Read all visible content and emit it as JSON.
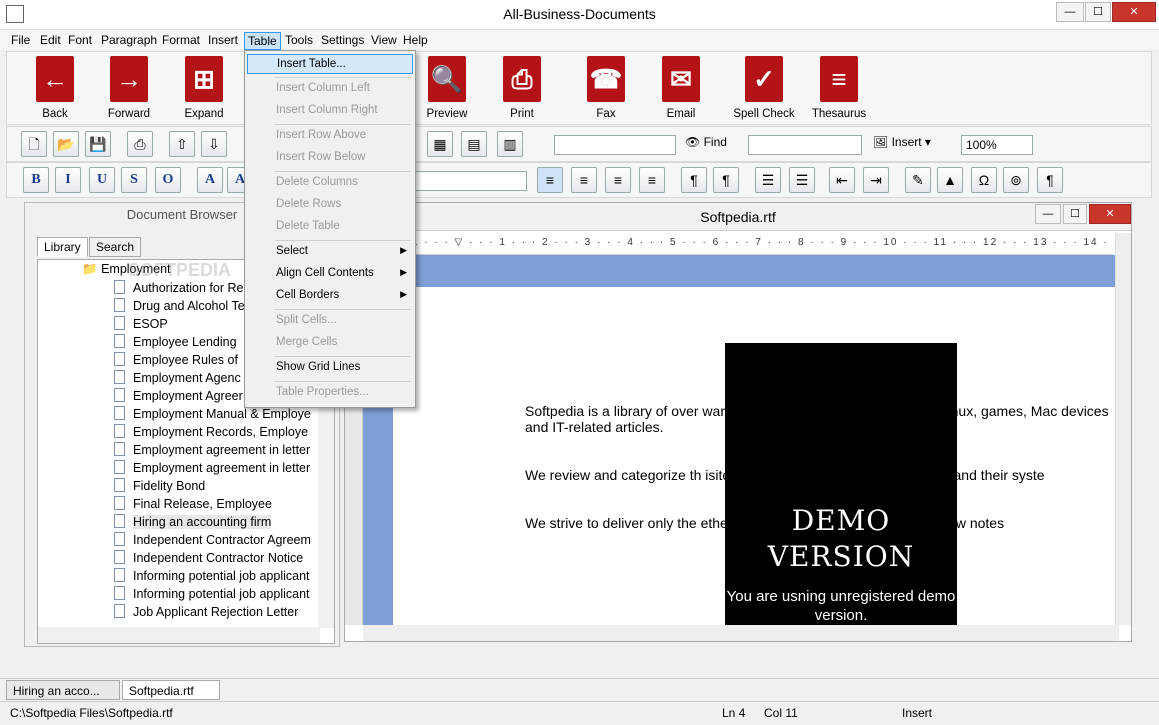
{
  "window": {
    "title": "All-Business-Documents",
    "minimize": "—",
    "maximize": "☐",
    "close": "✕"
  },
  "menubar": [
    "File",
    "Edit",
    "Font",
    "Paragraph",
    "Format",
    "Insert",
    "Table",
    "Tools",
    "Settings",
    "View",
    "Help"
  ],
  "big_toolbar": [
    {
      "label": "Back",
      "icon": "back-arrow-icon",
      "glyph": "←"
    },
    {
      "label": "Forward",
      "icon": "forward-arrow-icon",
      "glyph": "→"
    },
    {
      "label": "Expand",
      "icon": "expand-tree-icon",
      "glyph": "⊞"
    },
    {
      "label": "Preview",
      "icon": "preview-magnifier-icon",
      "glyph": "🔍"
    },
    {
      "label": "Print",
      "icon": "printer-icon",
      "glyph": "⎙"
    },
    {
      "label": "Fax",
      "icon": "fax-phone-icon",
      "glyph": "☎"
    },
    {
      "label": "Email",
      "icon": "email-envelope-icon",
      "glyph": "✉"
    },
    {
      "label": "Spell Check",
      "icon": "spell-check-icon",
      "glyph": "✓"
    },
    {
      "label": "Thesaurus",
      "icon": "thesaurus-book-icon",
      "glyph": "≡"
    }
  ],
  "toolbar2": {
    "find_label": "Find",
    "insert_label": "Insert",
    "zoom": "100%",
    "search_value": "",
    "style_value": ""
  },
  "format_buttons": [
    "B",
    "I",
    "U",
    "S",
    "O",
    "A",
    "A"
  ],
  "font_value": "",
  "doc_browser": {
    "title": "Document Browser",
    "tabs": [
      "Library",
      "Search"
    ],
    "folder": "Employment",
    "watermark": "SOFTPEDIA",
    "items": [
      "Authorization for Re",
      "Drug and Alcohol Te",
      "ESOP",
      "Employee Lending",
      "Employee Rules of",
      "Employment Agenc",
      "Employment Agreer",
      "Employment Manual & Employe",
      "Employment Records, Employe",
      "Employment agreement in letter",
      "Employment agreement in letter",
      "Fidelity Bond",
      "Final Release, Employee",
      "Hiring an accounting firm",
      "Independent Contractor Agreem",
      "Independent Contractor Notice",
      "Informing potential job applicant",
      "Informing potential job applicant",
      "Job Applicant Rejection Letter"
    ]
  },
  "editor": {
    "title": "Softpedia.rtf",
    "paragraphs": [
      "Softpedia is a library of over                                                    ware programs for Windows and Unix/Linux, games, Mac                                    devices and IT-related articles.",
      "We review and categorize th                                                   isitor/user to find the exact product they and their syste",
      "We strive to deliver only the                                              ether with self-made evaluation and review notes"
    ],
    "demo_title": "DEMO VERSION",
    "demo_text": "You are usning unregistered demo version."
  },
  "table_menu": [
    {
      "label": "Insert Table...",
      "enabled": true,
      "highlighted": true
    },
    {
      "label": "Insert Column Left",
      "enabled": false
    },
    {
      "label": "Insert Column Right",
      "enabled": false
    },
    {
      "label": "Insert Row Above",
      "enabled": false
    },
    {
      "label": "Insert Row Below",
      "enabled": false
    },
    {
      "label": "Delete Columns",
      "enabled": false
    },
    {
      "label": "Delete Rows",
      "enabled": false
    },
    {
      "label": "Delete Table",
      "enabled": false
    },
    {
      "label": "Select",
      "enabled": true,
      "submenu": true
    },
    {
      "label": "Align Cell Contents",
      "enabled": true,
      "submenu": true
    },
    {
      "label": "Cell Borders",
      "enabled": true,
      "submenu": true
    },
    {
      "label": "Split Cells...",
      "enabled": false
    },
    {
      "label": "Merge Cells",
      "enabled": false
    },
    {
      "label": "Show Grid Lines",
      "enabled": true
    },
    {
      "label": "Table Properties...",
      "enabled": false
    }
  ],
  "doc_tabs": [
    "Hiring an acco...",
    "Softpedia.rtf"
  ],
  "status": {
    "path": "C:\\Softpedia Files\\Softpedia.rtf",
    "line": "Ln 4",
    "col": "Col 11",
    "mode": "Insert"
  }
}
